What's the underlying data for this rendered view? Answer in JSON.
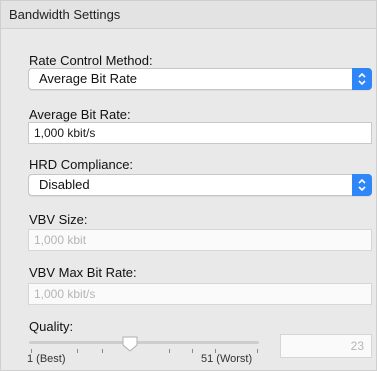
{
  "panel": {
    "title": "Bandwidth Settings"
  },
  "rate_control": {
    "label": "Rate Control Method:",
    "selected": "Average Bit Rate"
  },
  "average_bit_rate": {
    "label": "Average Bit Rate:",
    "value": "1,000 kbit/s"
  },
  "hrd_compliance": {
    "label": "HRD Compliance:",
    "selected": "Disabled"
  },
  "vbv_size": {
    "label": "VBV Size:",
    "placeholder": "1,000 kbit"
  },
  "vbv_max_bit_rate": {
    "label": "VBV Max Bit Rate:",
    "placeholder": "1,000 kbit/s"
  },
  "quality": {
    "label": "Quality:",
    "min_label": "1 (Best)",
    "max_label": "51 (Worst)",
    "field_value": "23"
  },
  "colors": {
    "accent": "#2f86f6"
  }
}
